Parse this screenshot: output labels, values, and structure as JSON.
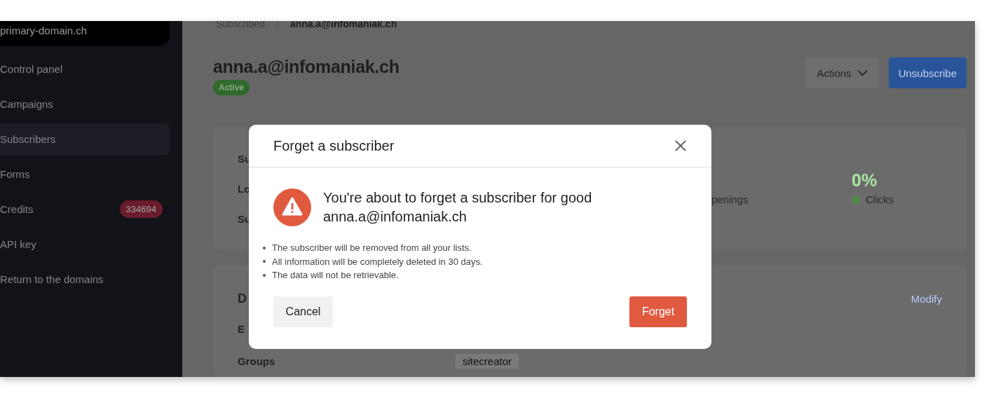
{
  "sidebar": {
    "domain": "primary-domain.ch",
    "items": [
      {
        "label": "Control panel",
        "selected": false
      },
      {
        "label": "Campaigns",
        "selected": false
      },
      {
        "label": "Subscribers",
        "selected": true
      },
      {
        "label": "Forms",
        "selected": false
      },
      {
        "label": "Credits",
        "selected": false,
        "badge": "334694"
      },
      {
        "label": "API key",
        "selected": false
      },
      {
        "label": "Return to the domains",
        "selected": false
      }
    ]
  },
  "breadcrumb": [
    "Subscribed",
    "anna.a@infomaniak.ch"
  ],
  "header": {
    "title": "anna.a@infomaniak.ch",
    "status": "Active",
    "actions": "Actions",
    "unsubscribe": "Unsubscribe"
  },
  "summary_card": {
    "labels": [
      "Su",
      "Lo",
      "Su"
    ],
    "stats": [
      {
        "label": "penings"
      },
      {
        "value": "0%",
        "label": "Clicks"
      }
    ]
  },
  "details_card": {
    "title": "D",
    "modify": "Modify",
    "rows": [
      {
        "label": "E"
      },
      {
        "label": "Groups",
        "value": "sitecreator"
      }
    ]
  },
  "modal": {
    "title": "Forget a subscriber",
    "message": "You're about to forget a subscriber for good",
    "email": "anna.a@infomaniak.ch",
    "bullets": [
      "The subscriber will be removed from all your lists.",
      "All information will be completely deleted in 30 days.",
      "The data will not be retrievable."
    ],
    "cancel": "Cancel",
    "confirm": "Forget"
  }
}
